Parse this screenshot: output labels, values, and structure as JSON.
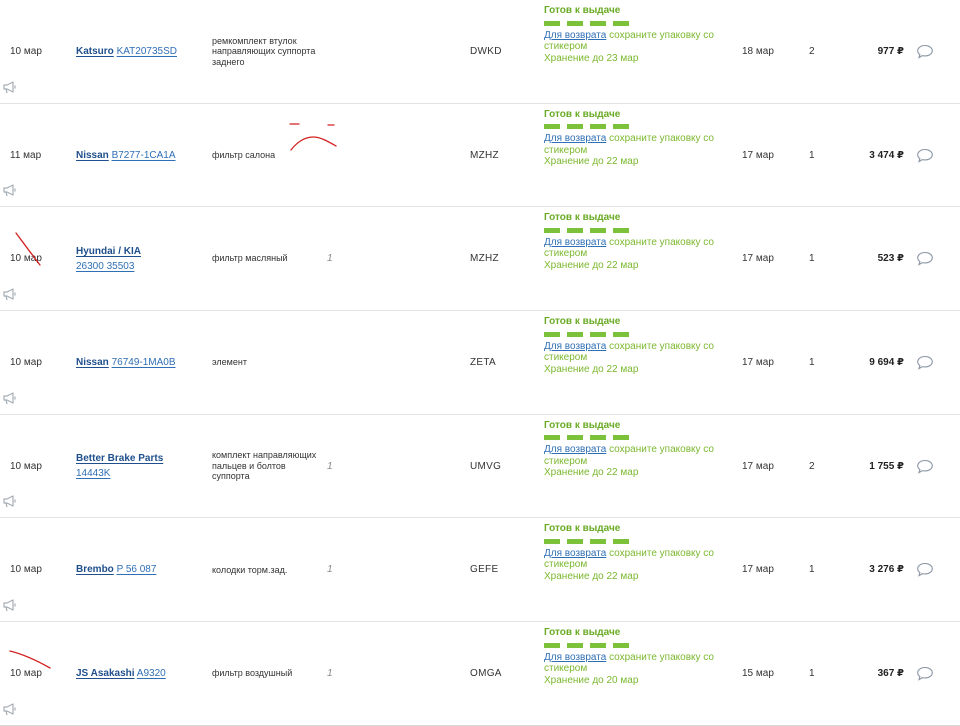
{
  "labels": {
    "status": "Готов к выдаче",
    "return_link": "Для возврата",
    "return_rest": "сохраните упаковку со стикером",
    "currency": "₽"
  },
  "colors": {
    "status_green": "#6aab25",
    "link_blue": "#2f6fb5",
    "brand_blue": "#1f4f8c",
    "scribble_red": "#d42020"
  },
  "orders": [
    {
      "date": "10 мар",
      "brand": "Katsuro",
      "article": "KAT20735SD",
      "brand_line2": false,
      "description": "ремкомплект втулок направляющих суппорта заднего",
      "mark": "",
      "code": "DWKD",
      "storage": "Хранение до 23 мар",
      "delivery": "18 мар",
      "qty": "2",
      "price": "977 ₽"
    },
    {
      "date": "11 мар",
      "brand": "Nissan",
      "article": "B7277-1CA1A",
      "brand_line2": false,
      "description": "фильтр салона",
      "mark": "",
      "code": "MZHZ",
      "storage": "Хранение до 22 мар",
      "delivery": "17 мар",
      "qty": "1",
      "price": "3 474 ₽"
    },
    {
      "date": "10 мар",
      "brand": "Hyundai / KIA",
      "article": "26300 35503",
      "brand_line2": true,
      "description": "фильтр масляный",
      "mark": "1",
      "code": "MZHZ",
      "storage": "Хранение до 22 мар",
      "delivery": "17 мар",
      "qty": "1",
      "price": "523 ₽"
    },
    {
      "date": "10 мар",
      "brand": "Nissan",
      "article": "76749-1MA0B",
      "brand_line2": false,
      "description": "элемент",
      "mark": "",
      "code": "ZETA",
      "storage": "Хранение до 22 мар",
      "delivery": "17 мар",
      "qty": "1",
      "price": "9 694 ₽"
    },
    {
      "date": "10 мар",
      "brand": "Better Brake Parts",
      "article": "14443K",
      "brand_line2": true,
      "description": "комплект направляющих пальцев и болтов суппорта",
      "mark": "1",
      "code": "UMVG",
      "storage": "Хранение до 22 мар",
      "delivery": "17 мар",
      "qty": "2",
      "price": "1 755 ₽"
    },
    {
      "date": "10 мар",
      "brand": "Brembo",
      "article": "P 56 087",
      "brand_line2": false,
      "description": "колодки торм.зад.",
      "mark": "1",
      "code": "GEFE",
      "storage": "Хранение до 22 мар",
      "delivery": "17 мар",
      "qty": "1",
      "price": "3 276 ₽"
    },
    {
      "date": "10 мар",
      "brand": "JS Asakashi",
      "article": "A9320",
      "brand_line2": false,
      "description": "фильтр воздушный",
      "mark": "1",
      "code": "OMGA",
      "storage": "Хранение до 20 мар",
      "delivery": "15 мар",
      "qty": "1",
      "price": "367 ₽"
    }
  ]
}
